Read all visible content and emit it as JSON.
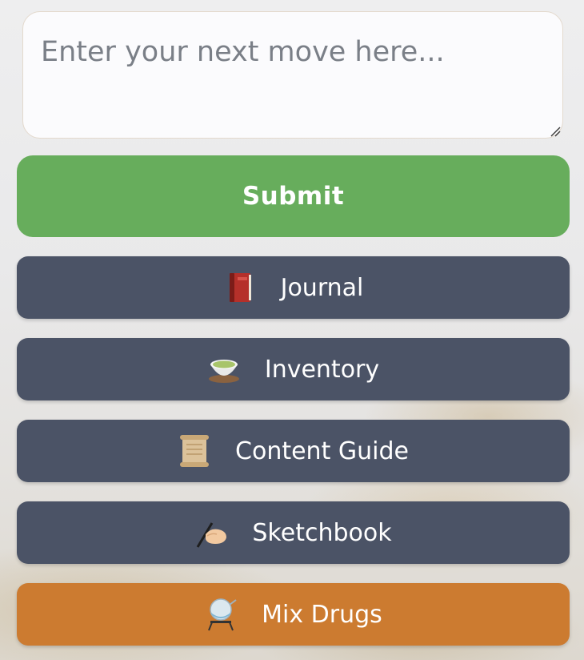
{
  "move_input": {
    "value": "",
    "placeholder": "Enter your next move here..."
  },
  "submit": {
    "label": "Submit",
    "color": "#67ad5c"
  },
  "menu": {
    "journal": {
      "label": "Journal",
      "icon": "red-book-icon"
    },
    "inventory": {
      "label": "Inventory",
      "icon": "tea-bowl-icon"
    },
    "content_guide": {
      "label": "Content Guide",
      "icon": "scroll-icon"
    },
    "sketchbook": {
      "label": "Sketchbook",
      "icon": "writing-hand-icon"
    },
    "mix_drugs": {
      "label": "Mix Drugs",
      "icon": "alembic-icon",
      "color": "#cc7b30"
    }
  },
  "colors": {
    "menu_button": "#4b5366",
    "submit_button": "#67ad5c",
    "mix_button": "#cc7b30"
  }
}
